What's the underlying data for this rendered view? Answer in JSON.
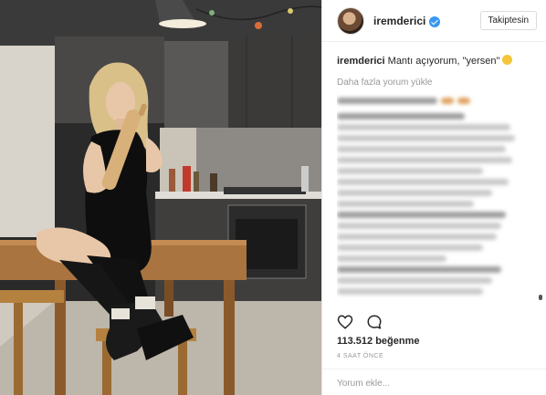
{
  "post": {
    "username": "iremderici",
    "follow_label": "Takiptesin",
    "caption_user": "iremderici",
    "caption_text": "Mantı açıyorum, \"yersen\"",
    "load_more": "Daha fazla yorum yükle",
    "likes": "113.512 beğenme",
    "time": "4 SAAT ÖNCE",
    "comment_placeholder": "Yorum ekle..."
  },
  "icons": {
    "verified": "verified-badge-icon",
    "like": "heart-icon",
    "comment": "comment-bubble-icon"
  },
  "colors": {
    "accent": "#3897f0",
    "text": "#262626",
    "muted": "#999999"
  }
}
